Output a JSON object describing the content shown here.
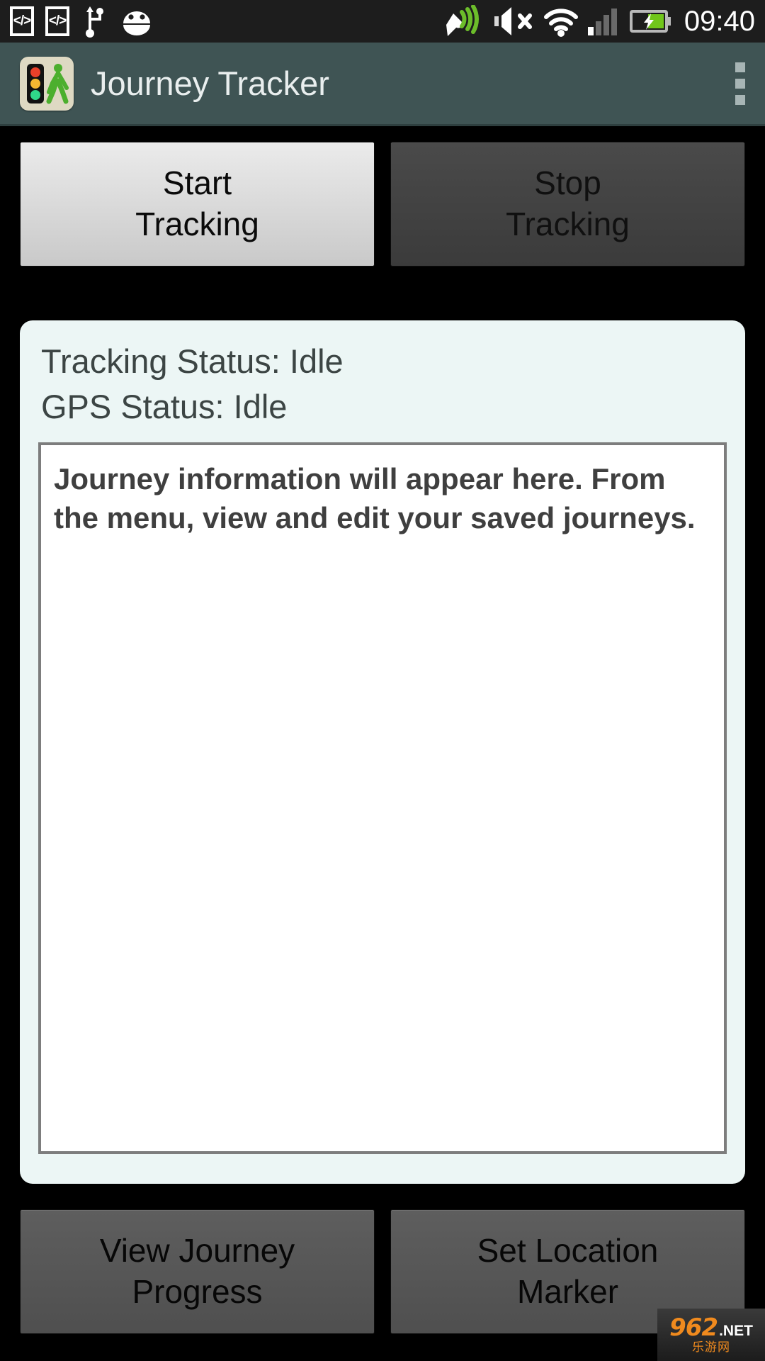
{
  "status_bar": {
    "icons": [
      {
        "name": "developer-code-icon",
        "glyph": "</>"
      },
      {
        "name": "developer-code-icon-2",
        "glyph": "</>"
      },
      {
        "name": "usb-icon",
        "glyph": "usb"
      },
      {
        "name": "android-debug-icon",
        "glyph": "android"
      },
      {
        "name": "gps-location-icon",
        "glyph": "gps"
      },
      {
        "name": "volume-mute-icon",
        "glyph": "mute"
      },
      {
        "name": "wifi-icon",
        "glyph": "wifi"
      },
      {
        "name": "cellular-signal-icon",
        "glyph": "signal"
      },
      {
        "name": "battery-charging-icon",
        "glyph": "battery"
      }
    ],
    "signal_bars_active": 1,
    "signal_bars_total": 4,
    "time": "09:40",
    "colors": {
      "background": "#1d1d1d",
      "gps_accent": "#6cbd2a",
      "battery_fill": "#71c61b"
    }
  },
  "action_bar": {
    "title": "Journey Tracker",
    "app_icon_name": "traffic-light-pedestrian-icon",
    "overflow_menu_label": "More options",
    "colors": {
      "background": "#3f5454",
      "title": "#e9eeee",
      "icon_plate": "#ded9c3",
      "traffic_red": "#e8402a",
      "traffic_amber": "#f5b731",
      "traffic_green": "#2fd98a",
      "pedestrian": "#4caf2e"
    }
  },
  "controls": {
    "start_tracking": "Start\nTracking",
    "start_tracking_line1": "Start",
    "start_tracking_line2": "Tracking",
    "start_tracking_enabled": true,
    "stop_tracking_line1": "Stop",
    "stop_tracking_line2": "Tracking",
    "stop_tracking_enabled": false,
    "view_journey_line1": "View Journey",
    "view_journey_line2": "Progress",
    "set_marker_line1": "Set Location",
    "set_marker_line2": "Marker"
  },
  "status_card": {
    "tracking_status": "Tracking Status: Idle",
    "gps_status": "GPS Status: Idle",
    "journey_info": "Journey information will appear here. From the menu, view and edit your saved journeys.",
    "colors": {
      "card_background": "#ecf6f5",
      "text": "#3c4544",
      "info_background": "#ffffff",
      "info_border": "#7d7d7d",
      "info_text": "#3f3f3f"
    }
  },
  "watermark": {
    "number": "962",
    "suffix": ".NET",
    "subtitle": "乐游网"
  }
}
